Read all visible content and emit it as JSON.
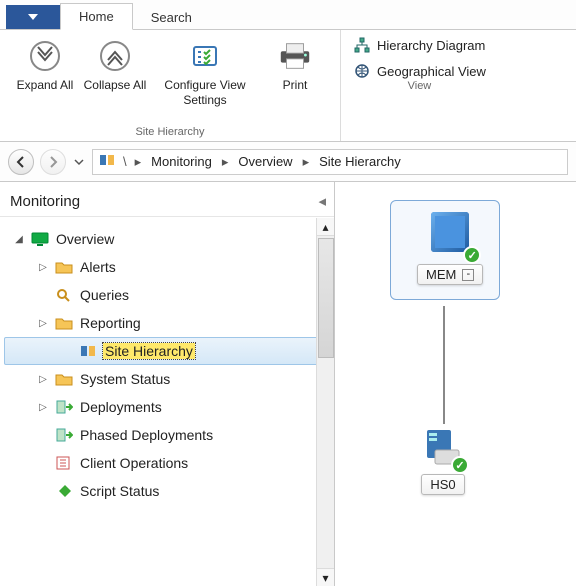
{
  "tabs": {
    "app": "",
    "home": "Home",
    "search": "Search"
  },
  "ribbon": {
    "expand": "Expand All",
    "collapse": "Collapse All",
    "configure": "Configure View Settings",
    "print": "Print",
    "group_hierarchy": "Site Hierarchy",
    "hierarchy_diagram": "Hierarchy Diagram",
    "geo_view": "Geographical View",
    "group_view": "View"
  },
  "breadcrumb": {
    "root_sep": "\\",
    "c1": "Monitoring",
    "c2": "Overview",
    "c3": "Site Hierarchy"
  },
  "nav": {
    "title": "Monitoring",
    "items": [
      {
        "label": "Overview",
        "level": 0,
        "exp": "open",
        "icon": "monitor"
      },
      {
        "label": "Alerts",
        "level": 1,
        "exp": "closed",
        "icon": "folder"
      },
      {
        "label": "Queries",
        "level": 1,
        "exp": "none",
        "icon": "search"
      },
      {
        "label": "Reporting",
        "level": 1,
        "exp": "closed",
        "icon": "folder"
      },
      {
        "label": "Site Hierarchy",
        "level": 2,
        "exp": "none",
        "icon": "site",
        "selected": true
      },
      {
        "label": "System Status",
        "level": 1,
        "exp": "closed",
        "icon": "folder"
      },
      {
        "label": "Deployments",
        "level": 1,
        "exp": "closed",
        "icon": "deploy"
      },
      {
        "label": "Phased Deployments",
        "level": 1,
        "exp": "none",
        "icon": "deploy"
      },
      {
        "label": "Client Operations",
        "level": 1,
        "exp": "none",
        "icon": "clientop"
      },
      {
        "label": "Script Status",
        "level": 1,
        "exp": "none",
        "icon": "script"
      }
    ]
  },
  "diagram": {
    "node1": {
      "label": "MEM",
      "toggle": "-"
    },
    "node2": {
      "label": "HS0"
    }
  }
}
